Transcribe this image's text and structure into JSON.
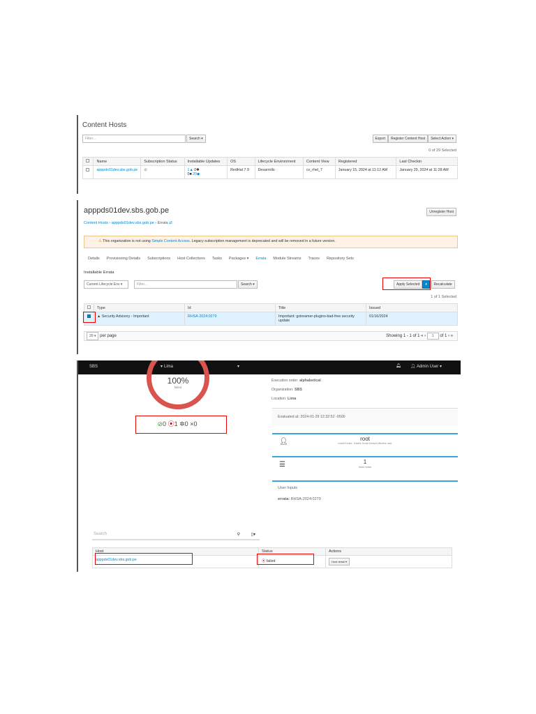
{
  "content_hosts": {
    "title": "Content Hosts",
    "filter_placeholder": "Filter...",
    "search": "Search",
    "export": "Export",
    "register": "Register Content Host",
    "select_action": "Select Action",
    "selected": "0 of 29 Selected",
    "columns": [
      "Name",
      "Subscription Status",
      "Installable Updates",
      "OS",
      "Lifecycle Environment",
      "Content View",
      "Registered",
      "Last Checkin"
    ],
    "row": {
      "name": "apppds01dev.sbs.gob.pe",
      "updates_security": "1",
      "updates_bug": "0",
      "updates_enh": "0",
      "updates_pkg": "20",
      "os": "RedHat 7.9",
      "env": "Desarrollo",
      "cv": "cv_rhel_7",
      "registered": "January 15, 2024 at 11:12 AM",
      "checkin": "January 29, 2024 at 11:28 AM"
    }
  },
  "host": {
    "title": "apppds01dev.sbs.gob.pe",
    "unregister": "Unregister Host",
    "breadcrumb": [
      "Content Hosts",
      "apppds01dev.sbs.gob.pe",
      "Errata"
    ],
    "alert_pre": "This organization is not using ",
    "alert_link": "Simple Content Access",
    "alert_post": ". Legacy subscription management is deprecated and will be removed in a future version.",
    "tabs": [
      "Details",
      "Provisioning Details",
      "Subscriptions",
      "Host Collections",
      "Tasks",
      "Packages ▾",
      "Errata",
      "Module Streams",
      "Traces",
      "Repository Sets"
    ],
    "section": "Installable Errata",
    "lifecycle": "Current Lifecycle Env",
    "filter_placeholder": "Filter...",
    "search": "Search",
    "apply": "Apply Selected",
    "recalculate": "Recalculate",
    "selected": "1 of 1 Selected",
    "columns": [
      "Type",
      "Id",
      "Title",
      "Issued"
    ],
    "row": {
      "type": "Security Advisory - Important",
      "id": "RHSA-2024:0279",
      "title": "Important: gstreamer-plugins-bad-free security update",
      "issued": "01/16/2024"
    },
    "per_page": "20",
    "per_page_label": "per page",
    "showing": "Showing 1 - 1 of 1",
    "page": "1",
    "of": "of 1"
  },
  "job": {
    "org": "SBS",
    "loc": "Lima",
    "user": "Admin User",
    "percent": "100%",
    "percent_label": "failed",
    "counts": {
      "success": "0",
      "failed": "1",
      "pending": "0",
      "cancelled": "0"
    },
    "exec_order_label": "Execution order:",
    "exec_order": "alphabetical",
    "org_label": "Organization:",
    "org_val": "SBS",
    "loc_label": "Location:",
    "loc_val": "Lima",
    "evaluated": "Evaluated at: 2024-01-29 12:32:52 -0500",
    "user_name": "root",
    "user_sub": "Install Errata - Katello Script Default effective user",
    "hosts_count": "1",
    "hosts_label": "total hosts",
    "inputs_title": "User Inputs",
    "errata_label": "errata:",
    "errata_val": "RHSA-2024:0279",
    "search_placeholder": "Search",
    "columns": [
      "Host",
      "Status",
      "Actions"
    ],
    "host": "apppds01dev.sbs.gob.pe",
    "status": "failed",
    "action": "Host detail"
  }
}
